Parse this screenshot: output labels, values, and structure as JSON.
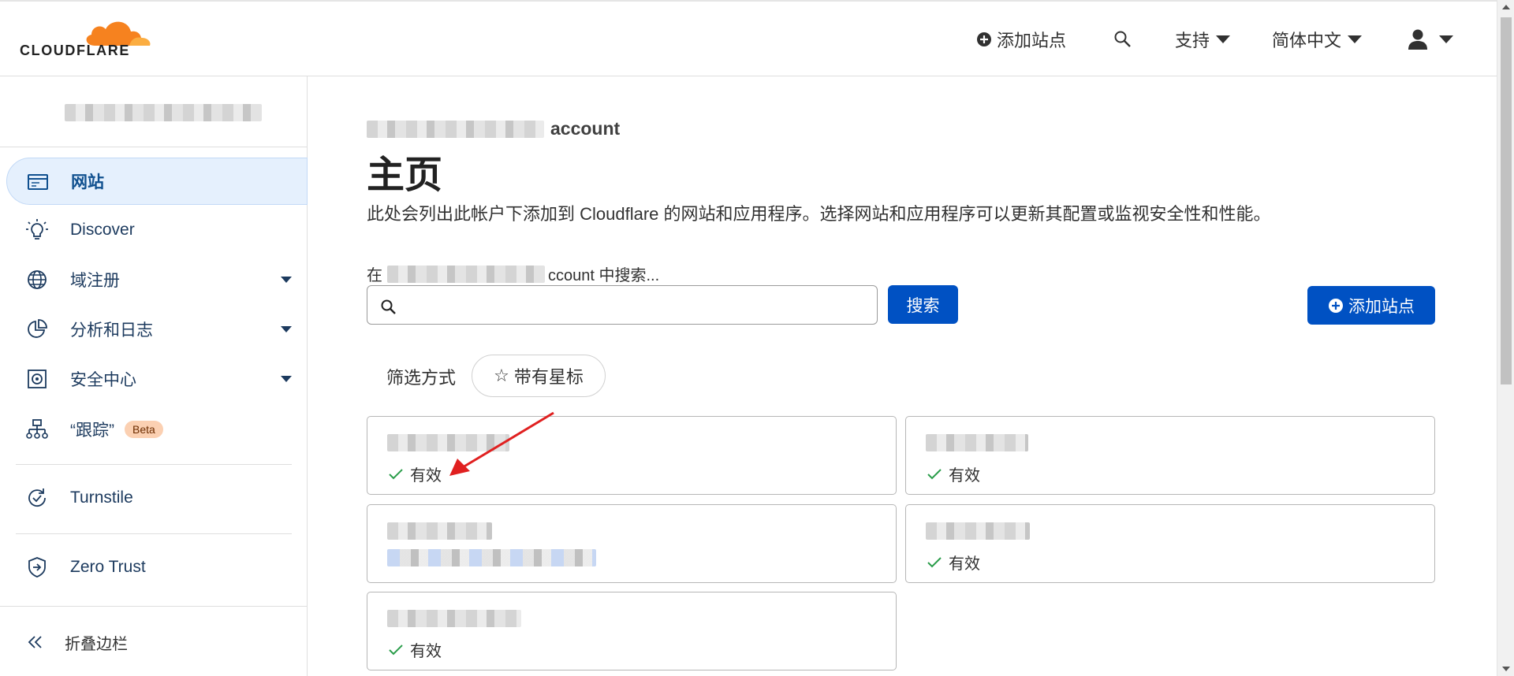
{
  "brand": {
    "name": "CLOUDFLARE",
    "accent": "#f6821f"
  },
  "header": {
    "add_site": "添加站点",
    "support": "支持",
    "language": "简体中文"
  },
  "sidebar": {
    "items": [
      {
        "label": "网站",
        "icon": "browser-window-icon",
        "active": true
      },
      {
        "label": "Discover",
        "icon": "lightbulb-icon"
      },
      {
        "label": "域注册",
        "icon": "globe-icon",
        "dropdown": true
      },
      {
        "label": "分析和日志",
        "icon": "pie-chart-icon",
        "dropdown": true
      },
      {
        "label": "安全中心",
        "icon": "shield-gear-icon",
        "dropdown": true
      },
      {
        "label": "“跟踪”",
        "icon": "network-tree-icon",
        "badge": "Beta"
      },
      {
        "label": "Turnstile",
        "icon": "refresh-check-icon"
      },
      {
        "label": "Zero Trust",
        "icon": "shield-arrow-icon"
      }
    ],
    "collapse": "折叠边栏"
  },
  "main": {
    "account_suffix": "account",
    "title": "主页",
    "description": "此处会列出此帐户下添加到 Cloudflare 的网站和应用程序。选择网站和应用程序可以更新其配置或监视安全性和性能。",
    "search_label_prefix": "在",
    "search_label_suffix": "ccount 中搜索...",
    "search_button": "搜索",
    "add_site_button": "添加站点",
    "filter_label": "筛选方式",
    "filter_starred": "带有星标",
    "sites": [
      {
        "status": "有效"
      },
      {
        "status": "有效"
      },
      {
        "status": ""
      },
      {
        "status": "有效"
      },
      {
        "status": "有效"
      }
    ]
  }
}
